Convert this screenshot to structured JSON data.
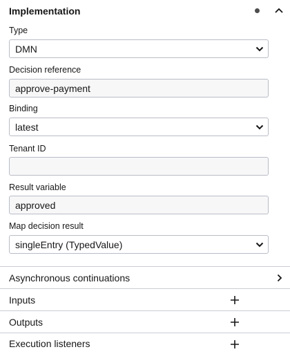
{
  "group": {
    "title": "Implementation"
  },
  "fields": {
    "type": {
      "label": "Type",
      "value": "DMN"
    },
    "decision_ref": {
      "label": "Decision reference",
      "value": "approve-payment"
    },
    "binding": {
      "label": "Binding",
      "value": "latest"
    },
    "tenant_id": {
      "label": "Tenant ID",
      "value": ""
    },
    "result_variable": {
      "label": "Result variable",
      "value": "approved"
    },
    "map_decision_result": {
      "label": "Map decision result",
      "value": "singleEntry (TypedValue)"
    }
  },
  "sections": {
    "async": {
      "label": "Asynchronous continuations"
    },
    "inputs": {
      "label": "Inputs"
    },
    "outputs": {
      "label": "Outputs"
    },
    "listeners": {
      "label": "Execution listeners"
    }
  },
  "icons": {
    "dot": "status-dot-icon",
    "collapse": "chevron-up-icon",
    "select": "chevron-down-icon",
    "add": "plus-icon",
    "expand": "chevron-right-icon"
  }
}
